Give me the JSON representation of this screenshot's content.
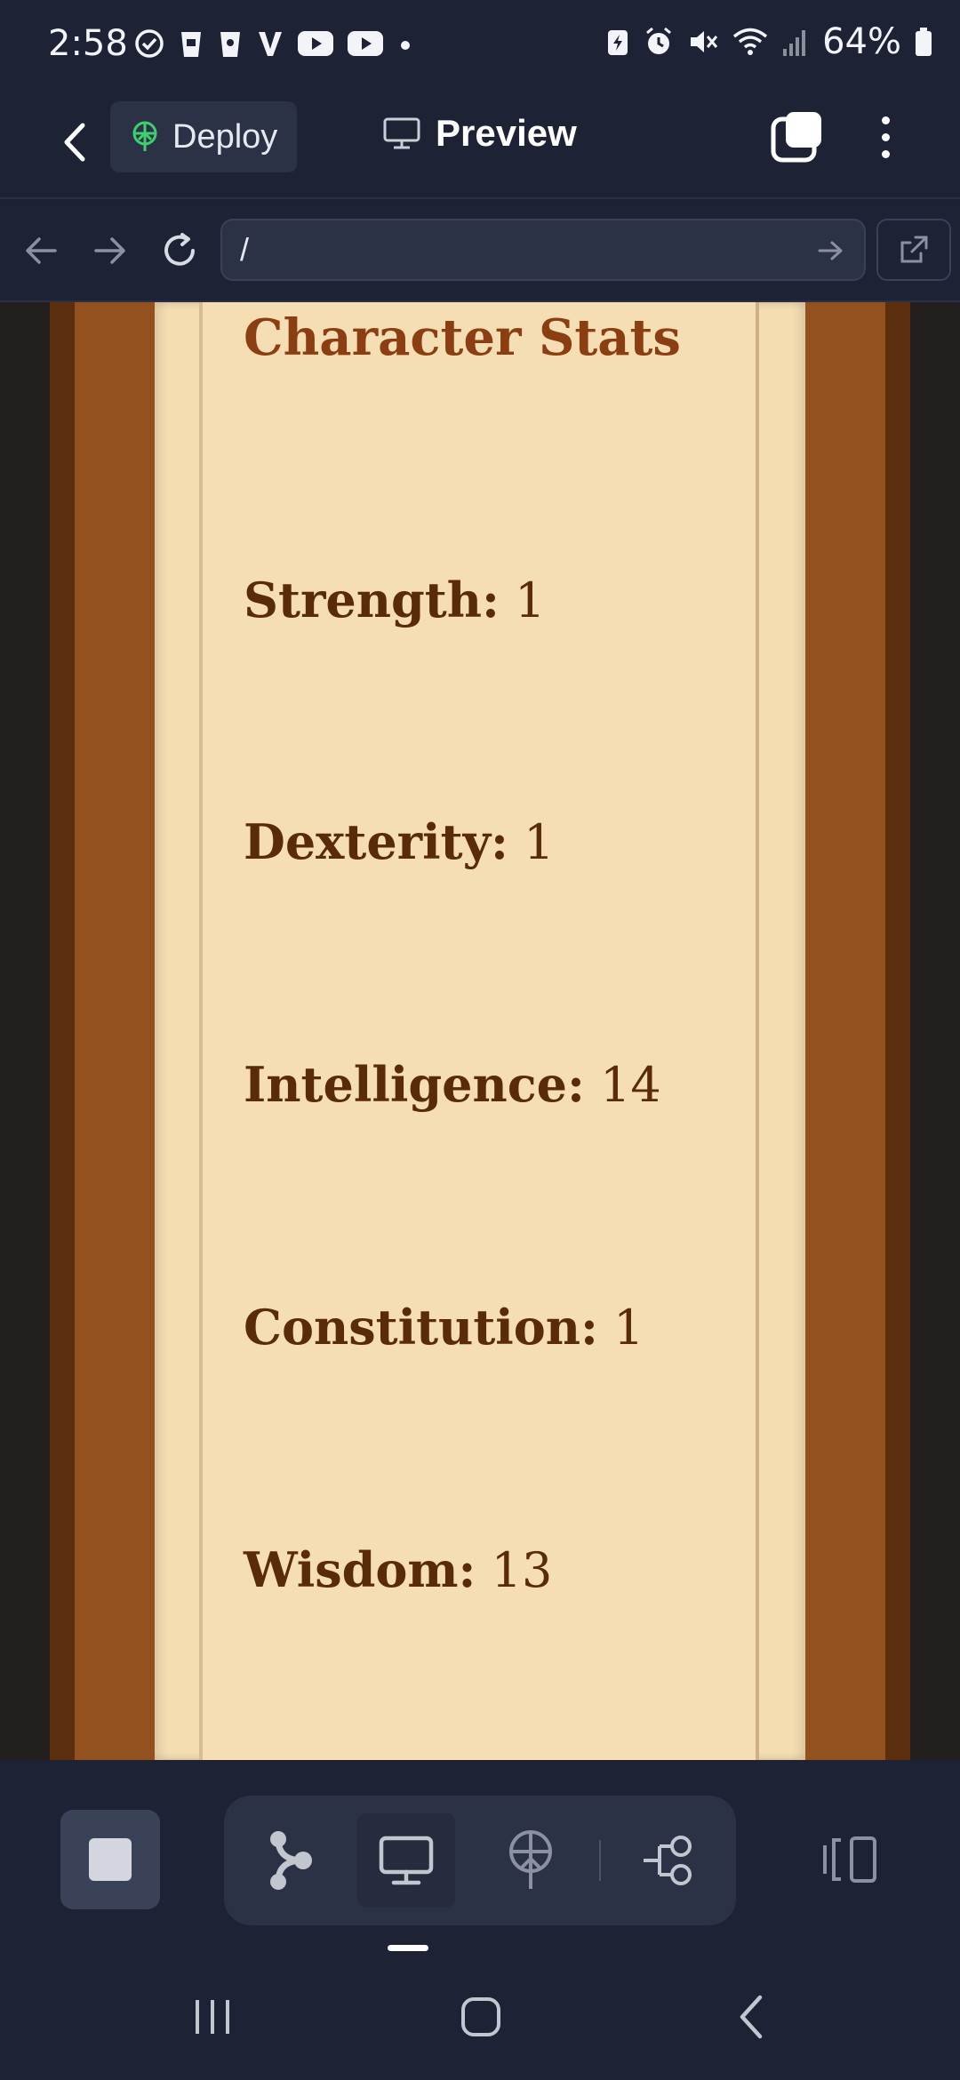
{
  "status_bar": {
    "time": "2:58",
    "battery_percent": "64%"
  },
  "app_bar": {
    "deploy_label": "Deploy",
    "preview_label": "Preview"
  },
  "url_bar": {
    "url_value": "/"
  },
  "content": {
    "title": "Character Stats",
    "stats": [
      {
        "label": "Strength:",
        "value": "1"
      },
      {
        "label": "Dexterity:",
        "value": "1"
      },
      {
        "label": "Intelligence:",
        "value": "14"
      },
      {
        "label": "Constitution:",
        "value": "1"
      },
      {
        "label": "Wisdom:",
        "value": "13"
      }
    ]
  },
  "colors": {
    "app_background": "#1d2234",
    "parchment": "#f5deb3",
    "wood": "#93511f",
    "heading_text": "#8a3e12",
    "stat_text": "#5a2b09",
    "deploy_icon": "#3ecf6e"
  },
  "icons": {
    "status_left": [
      "check-circle-icon",
      "coffee-icon",
      "coffee-icon",
      "v-icon",
      "youtube-icon",
      "youtube-icon",
      "dot-icon"
    ],
    "status_right": [
      "battery-saver-icon",
      "alarm-icon",
      "mute-icon",
      "wifi-icon",
      "signal-icon",
      "battery-icon"
    ],
    "bottom_tools": [
      "stop-icon",
      "branch-icon",
      "monitor-icon",
      "deploy-icon",
      "workflow-icon",
      "layout-icon"
    ]
  }
}
